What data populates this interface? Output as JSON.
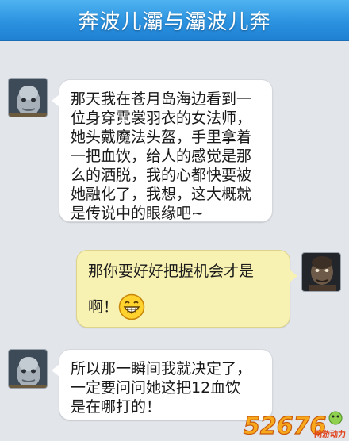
{
  "header": {
    "title": "奔波儿灞与灞波儿奔"
  },
  "messages": [
    {
      "side": "left",
      "lines": [
        "那天我在苍月岛海边看到一",
        "位身穿霓裳羽衣的女法师，",
        "她头戴魔法头盔，手里拿着",
        "一把血饮，给人的感觉是那",
        "么的洒脱，我的心都快要被",
        "她融化了，我想，这大概就",
        "是传说中的眼缘吧~"
      ]
    },
    {
      "side": "right",
      "lines": [
        "那你要好好把握机会才是",
        "啊！"
      ],
      "emoji": "grin-emoji"
    },
    {
      "side": "left",
      "lines": [
        "所以那一瞬间我就决定了，",
        "一定要问问她这把12血饮",
        "是在哪打的！"
      ]
    }
  ],
  "watermark": {
    "logo": "52676",
    "text": "网游动力"
  },
  "colors": {
    "title_bar": "#2b92e0",
    "background": "#e2e5ea",
    "left_bubble": "#ffffff",
    "right_bubble": "#f7f2b2"
  }
}
